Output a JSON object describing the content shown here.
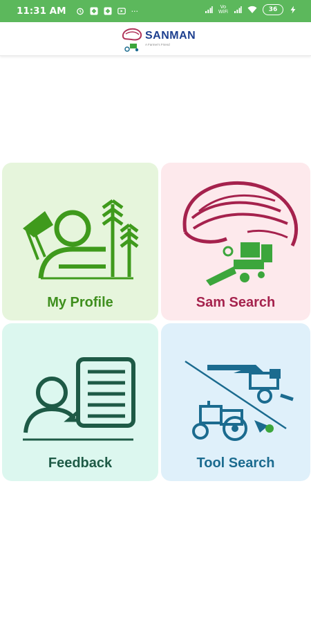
{
  "status_bar": {
    "time": "11:31 AM",
    "left_icons": [
      "alarm-icon",
      "app-notification-icon",
      "app-notification-icon",
      "media-icon",
      "more-icon"
    ],
    "overflow": "···",
    "network_label_top": "Vo",
    "network_label_bottom": "WiFi",
    "battery": "36",
    "right_icons": [
      "signal-icon",
      "signal-icon",
      "wifi-icon",
      "battery-icon",
      "charging-icon"
    ]
  },
  "header": {
    "logo_name": "SANMAN",
    "logo_tagline": "A Farmer's Friend"
  },
  "menu": [
    {
      "label": "My Profile",
      "bg": "#e6f5dc",
      "color": "#3f8f1e",
      "icon": "profile-icon"
    },
    {
      "label": "Sam Search",
      "bg": "#fde9ec",
      "color": "#a5224d",
      "icon": "sam-search-icon"
    },
    {
      "label": "Feedback",
      "bg": "#dcf7ef",
      "color": "#1e5a46",
      "icon": "feedback-icon"
    },
    {
      "label": "Tool Search",
      "bg": "#dff0fa",
      "color": "#1b6b8f",
      "icon": "tractor-icon"
    }
  ]
}
